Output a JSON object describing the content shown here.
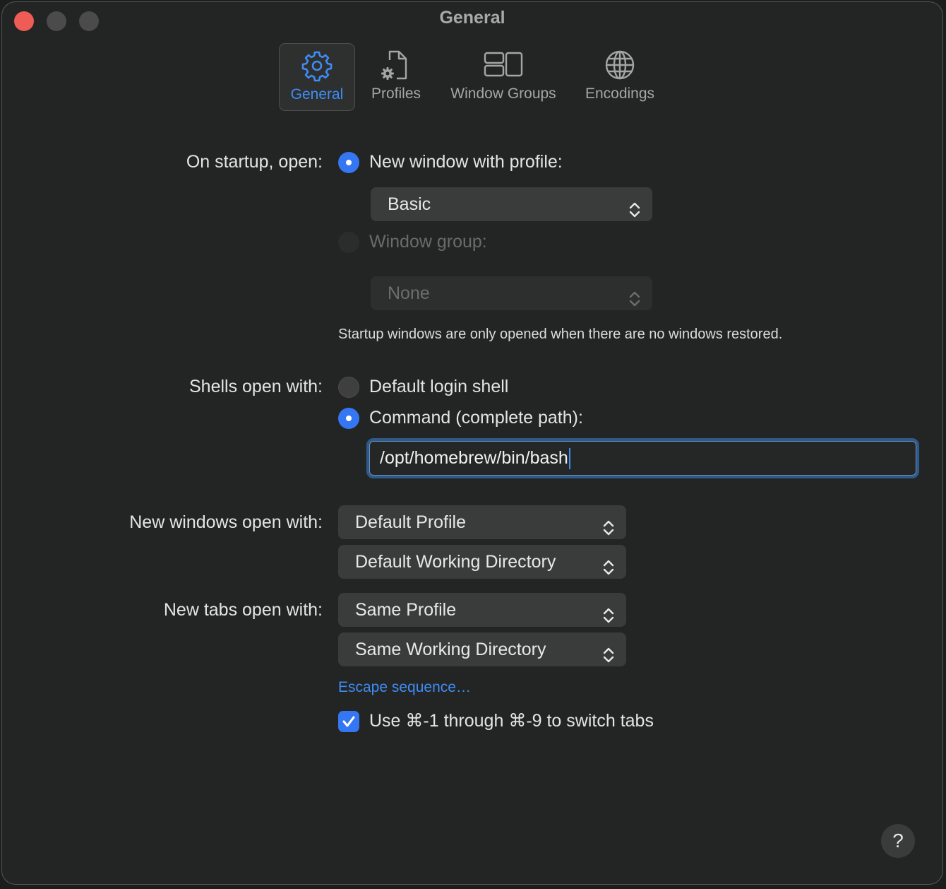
{
  "window": {
    "title": "General"
  },
  "toolbar": {
    "tabs": [
      {
        "label": "General",
        "icon": "gear-icon",
        "active": true
      },
      {
        "label": "Profiles",
        "icon": "document-gear-icon",
        "active": false
      },
      {
        "label": "Window Groups",
        "icon": "window-groups-icon",
        "active": false
      },
      {
        "label": "Encodings",
        "icon": "globe-icon",
        "active": false
      }
    ]
  },
  "startup": {
    "label": "On startup, open:",
    "new_window_option": "New window with profile:",
    "profile_value": "Basic",
    "window_group_option": "Window group:",
    "window_group_value": "None",
    "note": "Startup windows are only opened when there are no windows restored."
  },
  "shells": {
    "label": "Shells open with:",
    "default_option": "Default login shell",
    "command_option": "Command (complete path):",
    "command_value": "/opt/homebrew/bin/bash"
  },
  "new_windows": {
    "label": "New windows open with:",
    "profile_value": "Default Profile",
    "directory_value": "Default Working Directory"
  },
  "new_tabs": {
    "label": "New tabs open with:",
    "profile_value": "Same Profile",
    "directory_value": "Same Working Directory"
  },
  "escape_link": "Escape sequence…",
  "switch_tabs_checkbox": {
    "label": "Use ⌘-1 through ⌘-9 to switch tabs",
    "checked": true
  },
  "help_button": "?",
  "colors": {
    "accent": "#3576f2",
    "link": "#3f8cf5",
    "close": "#ed5d55"
  }
}
